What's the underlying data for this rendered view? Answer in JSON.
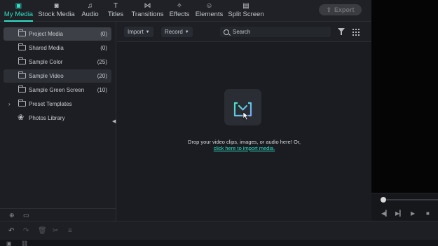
{
  "tabs": [
    {
      "label": "My Media",
      "icon": "image-icon",
      "glyph": "▣",
      "active": true
    },
    {
      "label": "Stock Media",
      "icon": "camera-icon",
      "glyph": "◙",
      "active": false
    },
    {
      "label": "Audio",
      "icon": "music-note-icon",
      "glyph": "♫",
      "active": false
    },
    {
      "label": "Titles",
      "icon": "text-icon",
      "glyph": "T",
      "active": false
    },
    {
      "label": "Transitions",
      "icon": "transition-icon",
      "glyph": "⋈",
      "active": false
    },
    {
      "label": "Effects",
      "icon": "sparkle-icon",
      "glyph": "✧",
      "active": false
    },
    {
      "label": "Elements",
      "icon": "elements-icon",
      "glyph": "☺",
      "active": false
    },
    {
      "label": "Split Screen",
      "icon": "split-screen-icon",
      "glyph": "▤",
      "active": false
    }
  ],
  "export": {
    "label": "Export",
    "icon": "upload-icon",
    "glyph": "⇪"
  },
  "sidebar": {
    "items": [
      {
        "name": "Project Media",
        "count": "(0)",
        "state": "selected",
        "icon": "folder-icon"
      },
      {
        "name": "Shared Media",
        "count": "(0)",
        "state": "",
        "icon": "folder-icon"
      },
      {
        "name": "Sample Color",
        "count": "(25)",
        "state": "",
        "icon": "folder-icon"
      },
      {
        "name": "Sample Video",
        "count": "(20)",
        "state": "highlight",
        "icon": "folder-icon"
      },
      {
        "name": "Sample Green Screen",
        "count": "(10)",
        "state": "",
        "icon": "folder-icon"
      },
      {
        "name": "Preset Templates",
        "count": "",
        "state": "",
        "icon": "folder-icon",
        "expandable": true
      },
      {
        "name": "Photos Library",
        "count": "",
        "state": "",
        "icon": "photos-icon"
      }
    ],
    "bottom": [
      {
        "icon": "new-folder-icon",
        "glyph": "⊕"
      },
      {
        "icon": "folder-outline-icon",
        "glyph": "▭"
      }
    ]
  },
  "media_bar": {
    "import_label": "Import",
    "record_label": "Record",
    "search_placeholder": "Search"
  },
  "empty_state": {
    "line1": "Drop your video clips, images, or audio here! Or,",
    "link": "click here to import media."
  },
  "colors": {
    "accent": "#2fe0c6",
    "background": "#1b1d22",
    "selected": "#3d4046"
  },
  "playback": {
    "progress": 0.0
  },
  "timeline_tools": [
    {
      "icon": "undo-icon",
      "glyph": "↶"
    },
    {
      "icon": "redo-icon",
      "glyph": "↷"
    },
    {
      "icon": "delete-icon",
      "glyph": "🗑"
    },
    {
      "icon": "cut-icon",
      "glyph": "✂"
    },
    {
      "icon": "menu-icon",
      "glyph": "≡"
    }
  ]
}
